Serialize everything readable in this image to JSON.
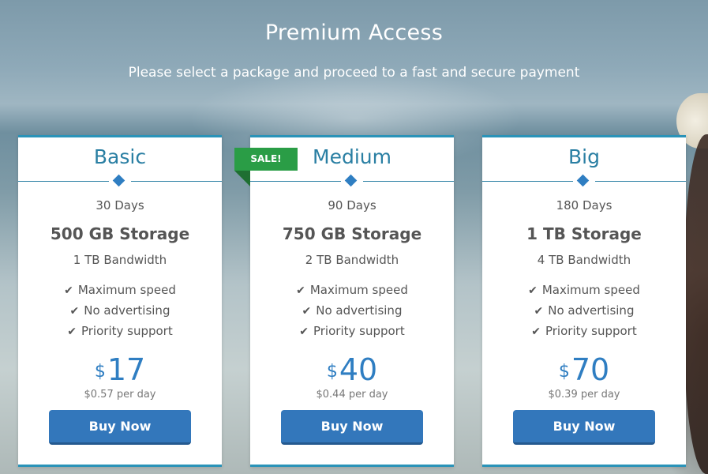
{
  "hero": {
    "title": "Premium Access",
    "subtitle": "Please select a package and proceed to a fast and secure payment"
  },
  "colors": {
    "accent": "#2a93b8",
    "plan_title": "#2a7fa3",
    "price": "#2f7ec2",
    "button": "#3377bb",
    "sale": "#2a9d46"
  },
  "feature_icon": "check-icon",
  "sale_badge": "SALE!",
  "plans": [
    {
      "name": "Basic",
      "days": "30 Days",
      "storage": "500 GB Storage",
      "bandwidth": "1 TB Bandwidth",
      "features": [
        "Maximum speed",
        "No advertising",
        "Priority support"
      ],
      "currency": "$",
      "price": "17",
      "per_day": "$0.57 per day",
      "button": "Buy Now"
    },
    {
      "name": "Medium",
      "days": "90 Days",
      "storage": "750 GB Storage",
      "bandwidth": "2 TB Bandwidth",
      "features": [
        "Maximum speed",
        "No advertising",
        "Priority support"
      ],
      "currency": "$",
      "price": "40",
      "per_day": "$0.44 per day",
      "button": "Buy Now"
    },
    {
      "name": "Big",
      "days": "180 Days",
      "storage": "1 TB Storage",
      "bandwidth": "4 TB Bandwidth",
      "features": [
        "Maximum speed",
        "No advertising",
        "Priority support"
      ],
      "currency": "$",
      "price": "70",
      "per_day": "$0.39 per day",
      "button": "Buy Now"
    }
  ]
}
